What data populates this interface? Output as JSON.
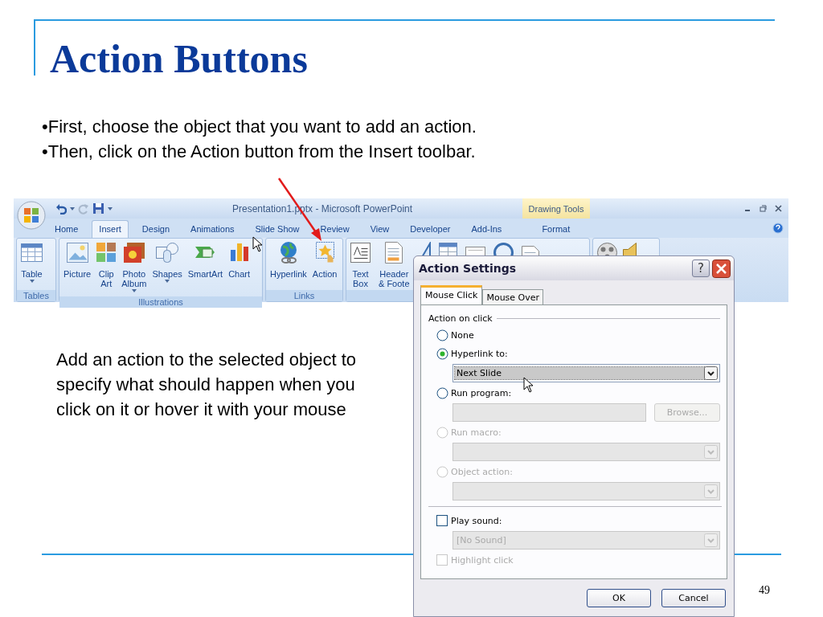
{
  "slide": {
    "title": "Action Buttons",
    "bullets": [
      "•First, choose the object that you want to add an action.",
      "•Then, click on the Action button from the Insert toolbar."
    ],
    "note": "Add an action to the selected object to specify what should happen when you click on it or hover it with your mouse",
    "page_number": "49"
  },
  "ribbon": {
    "window_title": "Presentation1.pptx - Microsoft PowerPoint",
    "contextual_header": "Drawing Tools",
    "tabs": [
      {
        "label": "Home",
        "selected": false
      },
      {
        "label": "Insert",
        "selected": true
      },
      {
        "label": "Design",
        "selected": false
      },
      {
        "label": "Animations",
        "selected": false
      },
      {
        "label": "Slide Show",
        "selected": false
      },
      {
        "label": "Review",
        "selected": false
      },
      {
        "label": "View",
        "selected": false
      },
      {
        "label": "Developer",
        "selected": false
      },
      {
        "label": "Add-Ins",
        "selected": false
      },
      {
        "label": "Format",
        "selected": false
      }
    ],
    "groups": [
      {
        "name": "Tables",
        "buttons": [
          {
            "kind": "table",
            "label": [
              "Table"
            ],
            "menu": true
          }
        ]
      },
      {
        "name": "Illustrations",
        "buttons": [
          {
            "kind": "picture",
            "label": [
              "Picture"
            ]
          },
          {
            "kind": "clipart",
            "label": [
              "Clip",
              "Art"
            ]
          },
          {
            "kind": "photo",
            "label": [
              "Photo",
              "Album"
            ],
            "menu": true
          },
          {
            "kind": "shapes",
            "label": [
              "Shapes"
            ],
            "menu": true
          },
          {
            "kind": "smartart",
            "label": [
              "SmartArt"
            ]
          },
          {
            "kind": "chart",
            "label": [
              "Chart"
            ]
          }
        ]
      },
      {
        "name": "Links",
        "buttons": [
          {
            "kind": "globe",
            "label": [
              "Hyperlink"
            ]
          },
          {
            "kind": "action",
            "label": [
              "Action"
            ]
          }
        ]
      },
      {
        "buttons": [
          {
            "kind": "textbox",
            "label": [
              "Text",
              "Box"
            ]
          },
          {
            "kind": "document",
            "label": [
              "Header",
              "& Foote"
            ]
          },
          {
            "kind": "slant"
          },
          {
            "kind": "griddoc"
          },
          {
            "kind": "rectangle"
          },
          {
            "kind": "circle"
          },
          {
            "kind": "object"
          }
        ]
      },
      {
        "buttons": [
          {
            "kind": "reel"
          },
          {
            "kind": "speaker"
          }
        ]
      }
    ]
  },
  "dialog": {
    "title": "Action Settings",
    "help_button": "?",
    "tabs": [
      {
        "label": "Mouse Click",
        "selected": true
      },
      {
        "label": "Mouse Over",
        "selected": false
      }
    ],
    "group_label": "Action on click",
    "options": [
      {
        "kind": "radio",
        "label": "None",
        "selected": false,
        "disabled": false
      },
      {
        "kind": "radio",
        "label": "Hyperlink to:",
        "selected": true,
        "disabled": false,
        "control": {
          "kind": "dropdown",
          "value": "Next Slide",
          "disabled": false
        }
      },
      {
        "kind": "radio",
        "label": "Run program:",
        "selected": false,
        "disabled": false,
        "control": {
          "kind": "field",
          "disabled": true,
          "button": "Browse..."
        }
      },
      {
        "kind": "radio",
        "label": "Run macro:",
        "selected": false,
        "disabled": true,
        "control": {
          "kind": "dropdown",
          "disabled": true
        }
      },
      {
        "kind": "radio",
        "label": "Object action:",
        "selected": false,
        "disabled": true,
        "control": {
          "kind": "dropdown",
          "disabled": true
        }
      },
      {
        "kind": "separator"
      },
      {
        "kind": "checkbox",
        "label": "Play sound:",
        "checked": false,
        "disabled": false,
        "control": {
          "kind": "dropdown",
          "value": "[No Sound]",
          "disabled": true
        }
      },
      {
        "kind": "checkbox",
        "label": "Highlight click",
        "checked": false,
        "disabled": true
      }
    ],
    "buttons": [
      "OK",
      "Cancel"
    ]
  }
}
